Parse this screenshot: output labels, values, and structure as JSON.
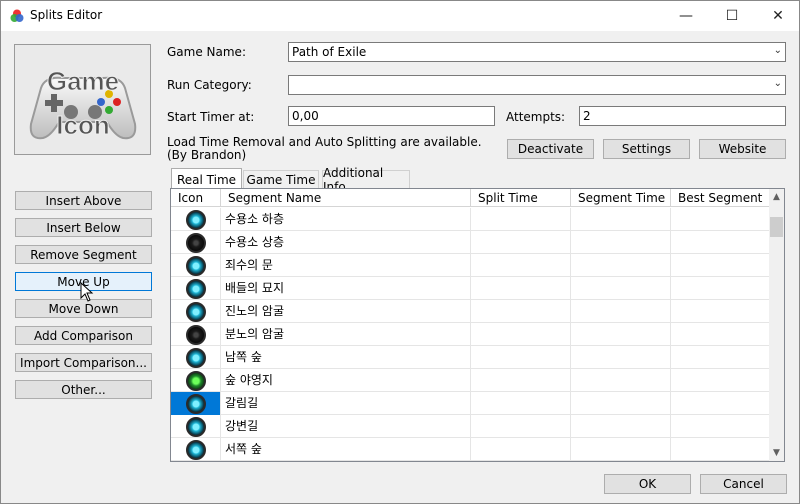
{
  "window": {
    "title": "Splits Editor",
    "minimize": "—",
    "maximize": "☐",
    "close": "✕"
  },
  "game_icon": {
    "lines": [
      "Game",
      "Icon"
    ]
  },
  "form": {
    "game_name_label": "Game Name:",
    "game_name_value": "Path of Exile",
    "run_category_label": "Run Category:",
    "run_category_value": "",
    "start_timer_label": "Start Timer at:",
    "start_timer_value": "0,00",
    "attempts_label": "Attempts:",
    "attempts_value": "2",
    "autosplit_text": "Load Time Removal and Auto Splitting are available. (By Brandon)"
  },
  "autosplit_buttons": {
    "deactivate": "Deactivate",
    "settings": "Settings",
    "website": "Website"
  },
  "side_buttons": {
    "insert_above": "Insert Above",
    "insert_below": "Insert Below",
    "remove_segment": "Remove Segment",
    "move_up": "Move Up",
    "move_down": "Move Down",
    "add_comparison": "Add Comparison",
    "import_comparison": "Import Comparison...",
    "other": "Other..."
  },
  "tabs": [
    {
      "label": "Real Time",
      "active": true
    },
    {
      "label": "Game Time",
      "active": false
    },
    {
      "label": "Additional Info",
      "active": false
    }
  ],
  "columns": [
    "Icon",
    "Segment Name",
    "Split Time",
    "Segment Time",
    "Best Segment"
  ],
  "rows": [
    {
      "name": "수용소 하층",
      "icon": "blue"
    },
    {
      "name": "수용소 상층",
      "icon": "dark"
    },
    {
      "name": "죄수의 문",
      "icon": "blue"
    },
    {
      "name": "배들의 묘지",
      "icon": "blue"
    },
    {
      "name": "진노의 암굴",
      "icon": "blue"
    },
    {
      "name": "분노의 암굴",
      "icon": "dark"
    },
    {
      "name": "남쪽 숲",
      "icon": "blue"
    },
    {
      "name": "숲 야영지",
      "icon": "green"
    },
    {
      "name": "갈림길",
      "icon": "blue",
      "selected": true
    },
    {
      "name": "강변길",
      "icon": "blue"
    },
    {
      "name": "서쪽 숲",
      "icon": "blue"
    }
  ],
  "dialog_buttons": {
    "ok": "OK",
    "cancel": "Cancel"
  },
  "colors": {
    "selection": "#0078d7",
    "focus": "#0078d7"
  }
}
